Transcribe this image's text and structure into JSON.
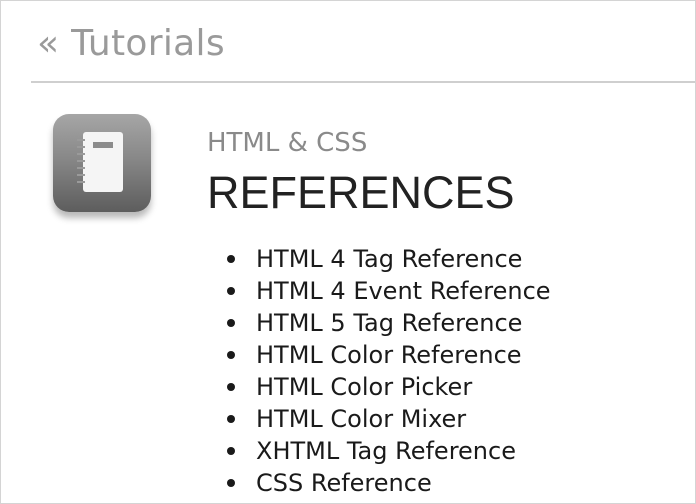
{
  "header": {
    "back_link": "« Tutorials"
  },
  "section": {
    "icon": "notebook-icon",
    "subtitle": "HTML & CSS",
    "title": "REFERENCES"
  },
  "references": [
    {
      "label": "HTML 4 Tag Reference"
    },
    {
      "label": "HTML 4 Event Reference"
    },
    {
      "label": "HTML 5 Tag Reference"
    },
    {
      "label": "HTML Color Reference"
    },
    {
      "label": "HTML Color Picker"
    },
    {
      "label": "HTML Color Mixer"
    },
    {
      "label": "XHTML Tag Reference"
    },
    {
      "label": "CSS Reference"
    }
  ]
}
